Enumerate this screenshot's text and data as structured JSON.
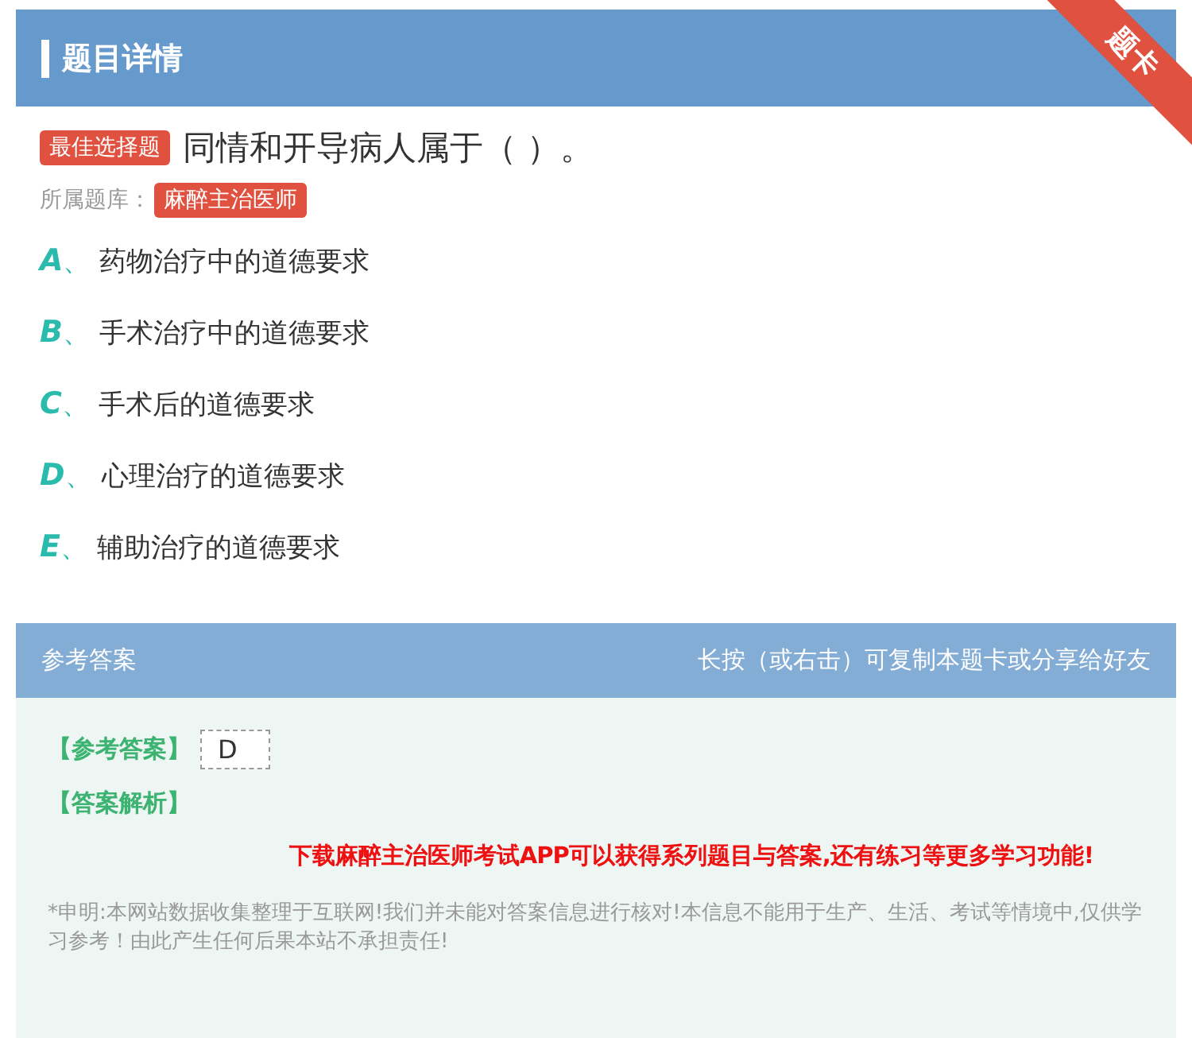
{
  "header": {
    "title": "题目详情",
    "ribbon": "题卡"
  },
  "question": {
    "type_tag": "最佳选择题",
    "text": "同情和开导病人属于（ ）。",
    "bank_label": "所属题库：",
    "bank": "麻醉主治医师"
  },
  "options": [
    {
      "letter": "A",
      "sep": "、",
      "text": "药物治疗中的道德要求"
    },
    {
      "letter": "B",
      "sep": "、",
      "text": "手术治疗中的道德要求"
    },
    {
      "letter": "C",
      "sep": "、",
      "text": "手术后的道德要求"
    },
    {
      "letter": "D",
      "sep": "、",
      "text": "心理治疗的道德要求"
    },
    {
      "letter": "E",
      "sep": "、",
      "text": "辅助治疗的道德要求"
    }
  ],
  "answer": {
    "title": "参考答案",
    "hint": "长按（或右击）可复制本题卡或分享给好友",
    "answer_label": "【参考答案】",
    "answer_value": "D",
    "analysis_label": "【答案解析】",
    "promo": "下载麻醉主治医师考试APP可以获得系列题目与答案,还有练习等更多学习功能!",
    "disclaimer": "*申明:本网站数据收集整理于互联网!我们并未能对答案信息进行核对!本信息不能用于生产、生活、考试等情境中,仅供学习参考！由此产生任何后果本站不承担责任!"
  }
}
